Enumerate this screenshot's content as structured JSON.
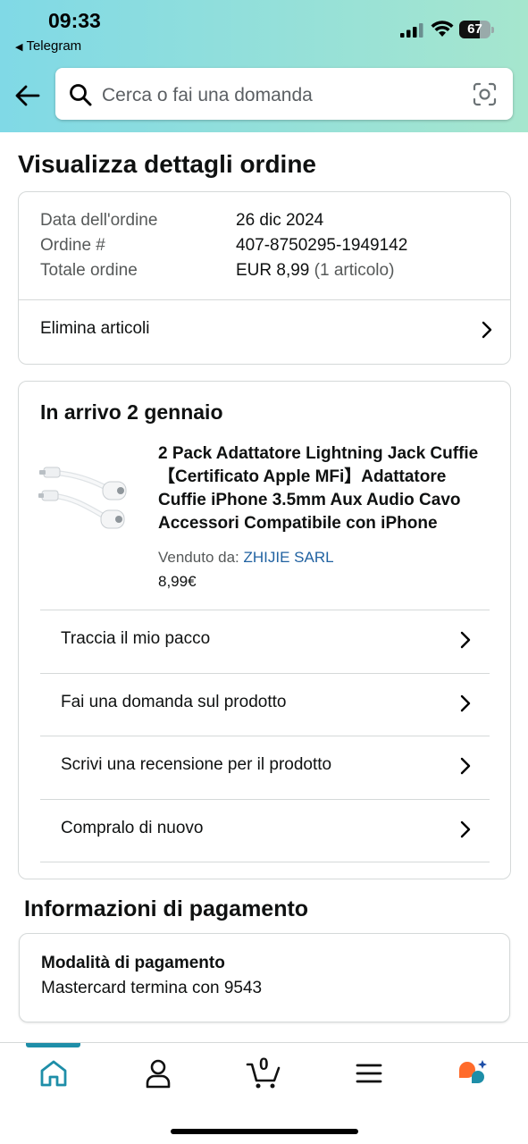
{
  "status_bar": {
    "time": "09:33",
    "back_app": "Telegram",
    "battery": "67"
  },
  "search": {
    "placeholder": "Cerca o fai una domanda"
  },
  "page_title": "Visualizza dettagli ordine",
  "order_summary": {
    "date_label": "Data dell'ordine",
    "date_value": "26 dic 2024",
    "number_label": "Ordine #",
    "number_value": "407-8750295-1949142",
    "total_label": "Totale ordine",
    "total_value": "EUR 8,99",
    "total_items": "(1 articolo)",
    "delete_items": "Elimina articoli"
  },
  "shipment": {
    "title": "In arrivo 2 gennaio",
    "product_title": "2 Pack Adattatore Lightning Jack Cuffie 【Certificato Apple MFi】Adattatore Cuffie iPhone 3.5mm Aux Audio Cavo Accessori Compatibile con iPhone",
    "seller_label": "Venduto da:",
    "seller_name": "ZHIJIE SARL",
    "price": "8,99€",
    "actions": [
      "Traccia il mio pacco",
      "Fai una domanda sul prodotto",
      "Scrivi una recensione per il prodotto",
      "Compralo di nuovo"
    ]
  },
  "payment": {
    "title": "Informazioni di pagamento",
    "method_label": "Modalità di pagamento",
    "method_value": "Mastercard termina con 9543"
  },
  "tabbar": {
    "cart_count": "0",
    "active_color": "#1e8ea8"
  }
}
